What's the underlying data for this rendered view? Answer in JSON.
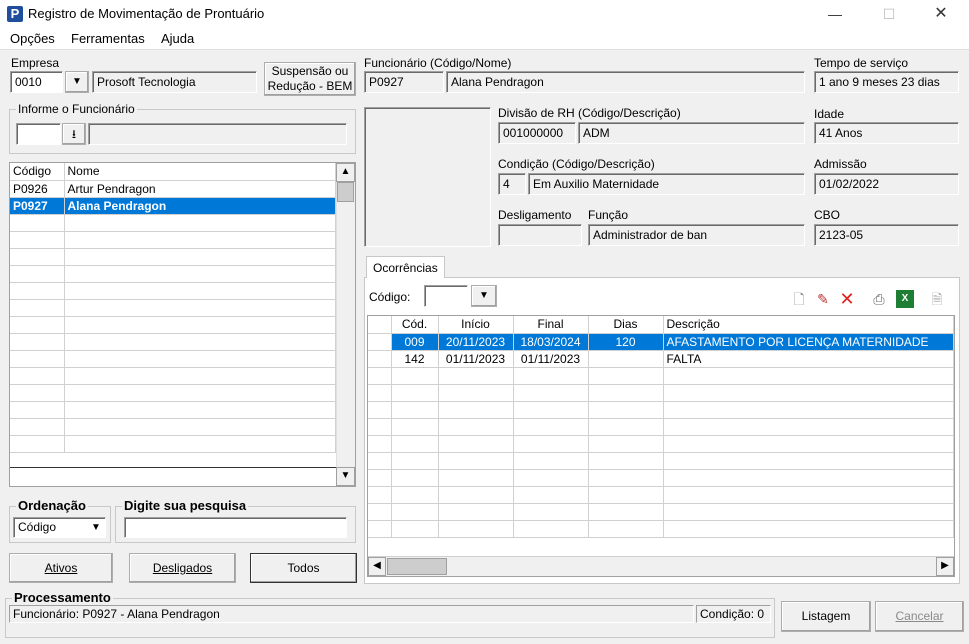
{
  "window": {
    "title": "Registro de Movimentação de Prontuário",
    "icon_letter": "P",
    "minimize": "—",
    "maximize": "☐",
    "close": "✕"
  },
  "menu": [
    "Opções",
    "Ferramentas",
    "Ajuda"
  ],
  "empresa": {
    "label": "Empresa",
    "code": "0010",
    "name": "Prosoft Tecnologia"
  },
  "suspensao_button": [
    "Suspensão ou",
    "Redução - BEM"
  ],
  "informe": {
    "title": "Informe o Funcionário",
    "value": ""
  },
  "employee_list": {
    "headers": [
      "Código",
      "Nome"
    ],
    "rows": [
      {
        "code": "P0926",
        "name": "Artur Pendragon"
      },
      {
        "code": "P0927",
        "name": "Alana Pendragon"
      }
    ]
  },
  "ordenacao": {
    "title": "Ordenação",
    "value": "Código"
  },
  "pesquisa": {
    "title": "Digite sua pesquisa",
    "value": ""
  },
  "filter_buttons": [
    "Ativos",
    "Desligados",
    "Todos"
  ],
  "funcionario": {
    "label": "Funcionário (Código/Nome)",
    "code": "P0927",
    "name": "Alana Pendragon"
  },
  "tempo_servico": {
    "label": "Tempo de serviço",
    "value": "1 ano 9 meses 23 dias"
  },
  "divisao": {
    "label": "Divisão de RH (Código/Descrição)",
    "code": "001000000",
    "desc": "ADM"
  },
  "idade": {
    "label": "Idade",
    "value": "41 Anos"
  },
  "condicao": {
    "label": "Condição (Código/Descrição)",
    "code": "4",
    "desc": "Em Auxilio Maternidade"
  },
  "admissao": {
    "label": "Admissão",
    "value": "01/02/2022"
  },
  "desligamento": {
    "label": "Desligamento",
    "value": ""
  },
  "funcao": {
    "label": "Função",
    "value": "Administrador de ban"
  },
  "cbo": {
    "label": "CBO",
    "value": "2123-05"
  },
  "ocorrencias": {
    "tab": "Ocorrências",
    "codigo_label": "Código:",
    "headers": [
      "Cód.",
      "Início",
      "Final",
      "Dias",
      "Descrição"
    ],
    "rows": [
      {
        "cod": "009",
        "inicio": "20/11/2023",
        "final": "18/03/2024",
        "dias": "120",
        "desc": "AFASTAMENTO POR LICENÇA MATERNIDADE"
      },
      {
        "cod": "142",
        "inicio": "01/11/2023",
        "final": "01/11/2023",
        "dias": "",
        "desc": "FALTA"
      }
    ],
    "toolbar_icons": [
      "new-document-icon",
      "edit-pencil-icon",
      "delete-x-icon",
      "print-icon",
      "excel-export-icon",
      "report-preview-icon"
    ]
  },
  "processamento": {
    "title": "Processamento",
    "status": "Funcionário: P0927 - Alana Pendragon",
    "condicao": "Condição: 0"
  },
  "bottom_buttons": {
    "listagem": "Listagem",
    "cancelar": "Cancelar"
  },
  "colors": {
    "selection": "#0078d7",
    "title_icon": "#1f4e9c"
  }
}
